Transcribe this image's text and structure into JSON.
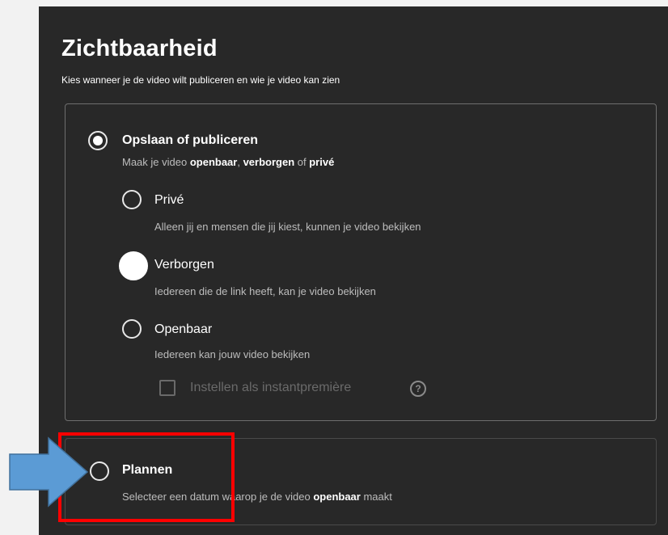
{
  "dialog": {
    "title": "Zichtbaarheid",
    "subtitle": "Kies wanneer je de video wilt publiceren en wie je video kan zien"
  },
  "save_publish": {
    "label": "Opslaan of publiceren",
    "desc_prefix": "Maak je video ",
    "desc_public": "openbaar",
    "desc_sep1": ", ",
    "desc_unlisted": "verborgen",
    "desc_sep2": " of ",
    "desc_private": "privé",
    "selected": true
  },
  "options": {
    "private": {
      "label": "Privé",
      "desc": "Alleen jij en mensen die jij kiest, kunnen je video bekijken"
    },
    "unlisted": {
      "label": "Verborgen",
      "desc": "Iedereen die de link heeft, kan je video bekijken"
    },
    "public": {
      "label": "Openbaar",
      "desc": "Iedereen kan jouw video bekijken"
    }
  },
  "premiere": {
    "label": "Instellen als instantpremière",
    "help_glyph": "?"
  },
  "schedule": {
    "label": "Plannen",
    "desc_prefix": "Selecteer een datum waarop je de video ",
    "desc_public": "openbaar",
    "desc_suffix": " maakt"
  },
  "annotations": {
    "highlight_color": "#ff0000",
    "arrow_color": "#5b9bd5"
  }
}
